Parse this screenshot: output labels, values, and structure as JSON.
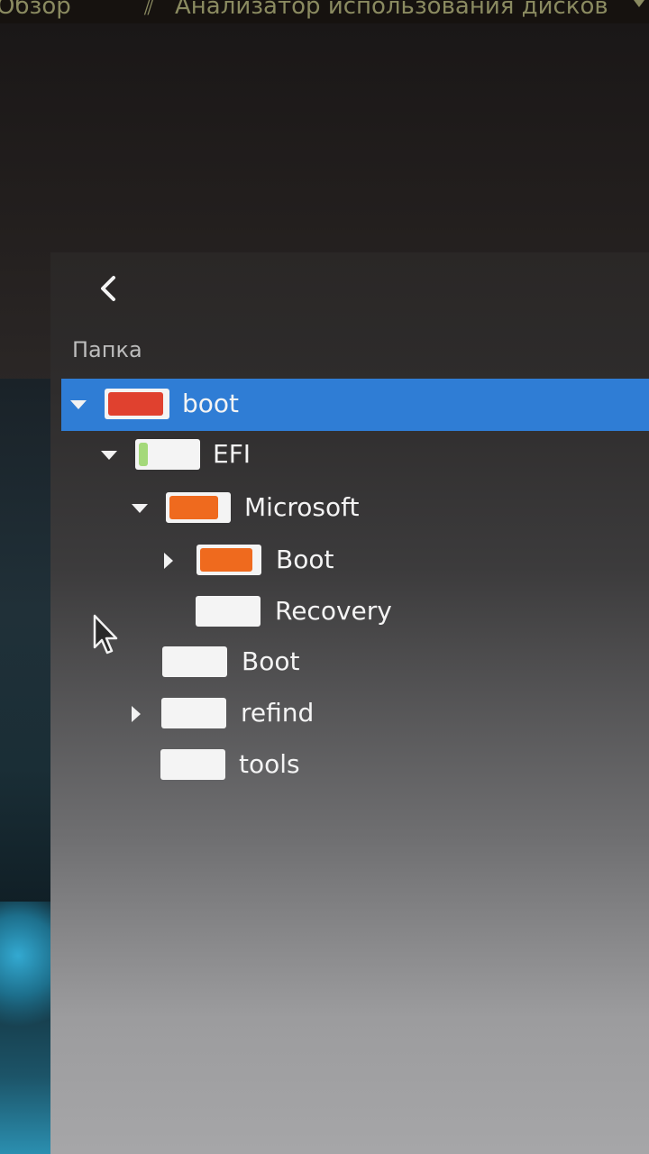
{
  "topbar": {
    "overview_label": "Обзор",
    "app_label": "Анализатор использования дисков"
  },
  "tree": {
    "column_header": "Папка",
    "rows": [
      {
        "label": "boot",
        "usage_fraction": 0.95,
        "bar_color": "#e0412f",
        "expander": "expanded",
        "selected": true
      },
      {
        "label": "EFI",
        "usage_fraction": 0.15,
        "bar_color": "#a4d97a",
        "expander": "expanded",
        "selected": false
      },
      {
        "label": "Microsoft",
        "usage_fraction": 0.85,
        "bar_color": "#ef6a1e",
        "expander": "expanded",
        "selected": false
      },
      {
        "label": "Boot",
        "usage_fraction": 0.9,
        "bar_color": "#ef6a1e",
        "expander": "collapsed",
        "selected": false
      },
      {
        "label": "Recovery",
        "usage_fraction": 0.0,
        "bar_color": "#ef6a1e",
        "expander": "none",
        "selected": false
      },
      {
        "label": "Boot",
        "usage_fraction": 0.0,
        "bar_color": "#ef6a1e",
        "expander": "none",
        "selected": false
      },
      {
        "label": "refind",
        "usage_fraction": 0.0,
        "bar_color": "#ef6a1e",
        "expander": "collapsed",
        "selected": false
      },
      {
        "label": "tools",
        "usage_fraction": 0.0,
        "bar_color": "#ef6a1e",
        "expander": "none",
        "selected": false
      }
    ]
  },
  "colors": {
    "selection": "#2f7dd5",
    "bar_background": "#f4f4f4"
  }
}
